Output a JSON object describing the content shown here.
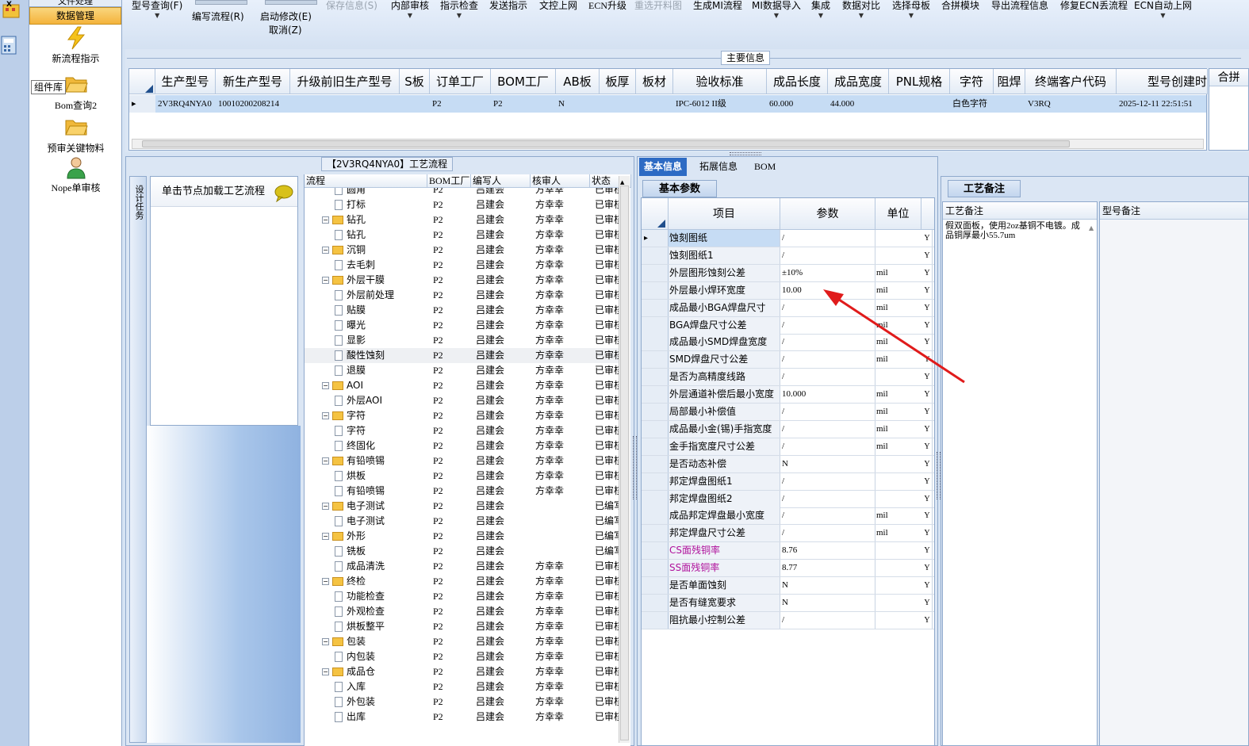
{
  "nav": {
    "top_label": "文件处理",
    "active_tab": "数据管理",
    "items": [
      {
        "label": "新流程指示"
      },
      {
        "label": "Bom查询2"
      },
      {
        "label": "预审关键物料"
      },
      {
        "label": "Nope单审核"
      }
    ],
    "tooltip": "组件库"
  },
  "toolbar": {
    "items": [
      {
        "label": "型号查询(F)",
        "dropdown": true,
        "disabled": false
      },
      {
        "label": "编写流程(R)",
        "dropdown": false,
        "disabled": false
      },
      {
        "label": "启动修改(E)",
        "dropdown": false,
        "disabled": false
      },
      {
        "label": "取消(Z)",
        "dropdown": false,
        "disabled": false
      },
      {
        "label": "保存信息(S)",
        "dropdown": false,
        "disabled": true
      },
      {
        "label": "内部审核",
        "dropdown": true,
        "disabled": false
      },
      {
        "label": "指示检查",
        "dropdown": true,
        "disabled": false
      },
      {
        "label": "发送指示",
        "dropdown": false,
        "disabled": false
      },
      {
        "label": "文控上网",
        "dropdown": false,
        "disabled": false
      },
      {
        "label": "ECN升级",
        "dropdown": false,
        "disabled": false
      },
      {
        "label": "重选开料图",
        "dropdown": false,
        "disabled": true
      },
      {
        "label": "生成MI流程",
        "dropdown": false,
        "disabled": false
      },
      {
        "label": "MI数据导入",
        "dropdown": true,
        "disabled": false
      },
      {
        "label": "集成",
        "dropdown": true,
        "disabled": false
      },
      {
        "label": "数据对比",
        "dropdown": true,
        "disabled": false
      },
      {
        "label": "选择母板",
        "dropdown": true,
        "disabled": false
      },
      {
        "label": "合拼模块",
        "dropdown": false,
        "disabled": false
      },
      {
        "label": "导出流程信息",
        "dropdown": false,
        "disabled": false
      },
      {
        "label": "修复ECN丢流程",
        "dropdown": false,
        "disabled": false
      },
      {
        "label": "ECN自动上网",
        "dropdown": true,
        "disabled": false
      }
    ]
  },
  "main_info": {
    "section_label": "主要信息",
    "right_label": "合拼",
    "columns": [
      "生产型号",
      "新生产型号",
      "升级前旧生产型号",
      "S板",
      "订单工厂",
      "BOM工厂",
      "AB板",
      "板厚",
      "板材",
      "验收标准",
      "成品长度",
      "成品宽度",
      "PNL规格",
      "字符",
      "阻焊",
      "终端客户代码",
      "型号创建时"
    ],
    "row": [
      "2V3RQ4NYA0",
      "10010200208214",
      "",
      "",
      "P2",
      "P2",
      "N",
      "",
      "",
      "IPC-6012 II级",
      "60.000",
      "44.000",
      "",
      "白色字符",
      "",
      "V3RQ",
      "2025-12-11 22:51:51"
    ]
  },
  "process": {
    "title": "【2V3RQ4NYA0】工艺流程",
    "side_tab": "设计任务",
    "load_hint": "单击节点加载工艺流程",
    "columns": [
      "流程",
      "BOM工厂",
      "编写人",
      "核审人",
      "状态"
    ],
    "rows": [
      {
        "name": "圆角",
        "level": 2,
        "bom": "P2",
        "writer": "吕建会",
        "reviewer": "方幸幸",
        "status": "已审核"
      },
      {
        "name": "打标",
        "level": 2,
        "bom": "P2",
        "writer": "吕建会",
        "reviewer": "方幸幸",
        "status": "已审核"
      },
      {
        "name": "钻孔",
        "level": 1,
        "bom": "P2",
        "writer": "吕建会",
        "reviewer": "方幸幸",
        "status": "已审核"
      },
      {
        "name": "钻孔",
        "level": 2,
        "bom": "P2",
        "writer": "吕建会",
        "reviewer": "方幸幸",
        "status": "已审核"
      },
      {
        "name": "沉铜",
        "level": 1,
        "bom": "P2",
        "writer": "吕建会",
        "reviewer": "方幸幸",
        "status": "已审核"
      },
      {
        "name": "去毛刺",
        "level": 2,
        "bom": "P2",
        "writer": "吕建会",
        "reviewer": "方幸幸",
        "status": "已审核"
      },
      {
        "name": "外层干膜",
        "level": 1,
        "bom": "P2",
        "writer": "吕建会",
        "reviewer": "方幸幸",
        "status": "已审核"
      },
      {
        "name": "外层前处理",
        "level": 2,
        "bom": "P2",
        "writer": "吕建会",
        "reviewer": "方幸幸",
        "status": "已审核"
      },
      {
        "name": "贴膜",
        "level": 2,
        "bom": "P2",
        "writer": "吕建会",
        "reviewer": "方幸幸",
        "status": "已审核"
      },
      {
        "name": "曝光",
        "level": 2,
        "bom": "P2",
        "writer": "吕建会",
        "reviewer": "方幸幸",
        "status": "已审核"
      },
      {
        "name": "显影",
        "level": 2,
        "bom": "P2",
        "writer": "吕建会",
        "reviewer": "方幸幸",
        "status": "已审核"
      },
      {
        "name": "酸性蚀刻",
        "level": 2,
        "bom": "P2",
        "writer": "吕建会",
        "reviewer": "方幸幸",
        "status": "已审核"
      },
      {
        "name": "退膜",
        "level": 2,
        "bom": "P2",
        "writer": "吕建会",
        "reviewer": "方幸幸",
        "status": "已审核"
      },
      {
        "name": "AOI",
        "level": 1,
        "bom": "P2",
        "writer": "吕建会",
        "reviewer": "方幸幸",
        "status": "已审核"
      },
      {
        "name": "外层AOI",
        "level": 2,
        "bom": "P2",
        "writer": "吕建会",
        "reviewer": "方幸幸",
        "status": "已审核"
      },
      {
        "name": "字符",
        "level": 1,
        "bom": "P2",
        "writer": "吕建会",
        "reviewer": "方幸幸",
        "status": "已审核"
      },
      {
        "name": "字符",
        "level": 2,
        "bom": "P2",
        "writer": "吕建会",
        "reviewer": "方幸幸",
        "status": "已审核"
      },
      {
        "name": "终固化",
        "level": 2,
        "bom": "P2",
        "writer": "吕建会",
        "reviewer": "方幸幸",
        "status": "已审核"
      },
      {
        "name": "有铅喷锡",
        "level": 1,
        "bom": "P2",
        "writer": "吕建会",
        "reviewer": "方幸幸",
        "status": "已审核"
      },
      {
        "name": "烘板",
        "level": 2,
        "bom": "P2",
        "writer": "吕建会",
        "reviewer": "方幸幸",
        "status": "已审核"
      },
      {
        "name": "有铅喷锡",
        "level": 2,
        "bom": "P2",
        "writer": "吕建会",
        "reviewer": "方幸幸",
        "status": "已审核"
      },
      {
        "name": "电子测试",
        "level": 1,
        "bom": "P2",
        "writer": "吕建会",
        "reviewer": "",
        "status": "已编写"
      },
      {
        "name": "电子测试",
        "level": 2,
        "bom": "P2",
        "writer": "吕建会",
        "reviewer": "",
        "status": "已编写"
      },
      {
        "name": "外形",
        "level": 1,
        "bom": "P2",
        "writer": "吕建会",
        "reviewer": "",
        "status": "已编写"
      },
      {
        "name": "铣板",
        "level": 2,
        "bom": "P2",
        "writer": "吕建会",
        "reviewer": "",
        "status": "已编写"
      },
      {
        "name": "成品清洗",
        "level": 2,
        "bom": "P2",
        "writer": "吕建会",
        "reviewer": "方幸幸",
        "status": "已审核"
      },
      {
        "name": "终检",
        "level": 1,
        "bom": "P2",
        "writer": "吕建会",
        "reviewer": "方幸幸",
        "status": "已审核"
      },
      {
        "name": "功能检查",
        "level": 2,
        "bom": "P2",
        "writer": "吕建会",
        "reviewer": "方幸幸",
        "status": "已审核"
      },
      {
        "name": "外观检查",
        "level": 2,
        "bom": "P2",
        "writer": "吕建会",
        "reviewer": "方幸幸",
        "status": "已审核"
      },
      {
        "name": "烘板整平",
        "level": 2,
        "bom": "P2",
        "writer": "吕建会",
        "reviewer": "方幸幸",
        "status": "已审核"
      },
      {
        "name": "包装",
        "level": 1,
        "bom": "P2",
        "writer": "吕建会",
        "reviewer": "方幸幸",
        "status": "已审核"
      },
      {
        "name": "内包装",
        "level": 2,
        "bom": "P2",
        "writer": "吕建会",
        "reviewer": "方幸幸",
        "status": "已审核"
      },
      {
        "name": "成品仓",
        "level": 1,
        "bom": "P2",
        "writer": "吕建会",
        "reviewer": "方幸幸",
        "status": "已审核"
      },
      {
        "name": "入库",
        "level": 2,
        "bom": "P2",
        "writer": "吕建会",
        "reviewer": "方幸幸",
        "status": "已审核"
      },
      {
        "name": "外包装",
        "level": 2,
        "bom": "P2",
        "writer": "吕建会",
        "reviewer": "方幸幸",
        "status": "已审核"
      },
      {
        "name": "出库",
        "level": 2,
        "bom": "P2",
        "writer": "吕建会",
        "reviewer": "方幸幸",
        "status": "已审核"
      }
    ],
    "selected_row": 11
  },
  "params": {
    "tabs": [
      "基本信息",
      "拓展信息",
      "BOM"
    ],
    "sub_tab": "基本参数",
    "columns": [
      "项目",
      "参数",
      "单位"
    ],
    "rows": [
      {
        "name": "蚀刻图纸",
        "value": "/",
        "unit": "",
        "flag": "Y",
        "highlight": false
      },
      {
        "name": "蚀刻图纸1",
        "value": "/",
        "unit": "",
        "flag": "Y",
        "highlight": false
      },
      {
        "name": "外层图形蚀刻公差",
        "value": "±10%",
        "unit": "mil",
        "flag": "Y",
        "highlight": false
      },
      {
        "name": "外层最小焊环宽度",
        "value": "10.00",
        "unit": "mil",
        "flag": "Y",
        "highlight": false
      },
      {
        "name": "成品最小BGA焊盘尺寸",
        "value": "/",
        "unit": "mil",
        "flag": "Y",
        "highlight": false
      },
      {
        "name": "BGA焊盘尺寸公差",
        "value": "/",
        "unit": "mil",
        "flag": "Y",
        "highlight": false
      },
      {
        "name": "成品最小SMD焊盘宽度",
        "value": "/",
        "unit": "mil",
        "flag": "Y",
        "highlight": false
      },
      {
        "name": "SMD焊盘尺寸公差",
        "value": "/",
        "unit": "mil",
        "flag": "Y",
        "highlight": false
      },
      {
        "name": "是否为高精度线路",
        "value": "/",
        "unit": "",
        "flag": "Y",
        "highlight": false
      },
      {
        "name": "外层通道补偿后最小宽度",
        "value": "10.000",
        "unit": "mil",
        "flag": "Y",
        "highlight": false
      },
      {
        "name": "局部最小补偿值",
        "value": "/",
        "unit": "mil",
        "flag": "Y",
        "highlight": false
      },
      {
        "name": "成品最小金(锡)手指宽度",
        "value": "/",
        "unit": "mil",
        "flag": "Y",
        "highlight": false
      },
      {
        "name": "金手指宽度尺寸公差",
        "value": "/",
        "unit": "mil",
        "flag": "Y",
        "highlight": false
      },
      {
        "name": "是否动态补偿",
        "value": "N",
        "unit": "",
        "flag": "Y",
        "highlight": false
      },
      {
        "name": "邦定焊盘图纸1",
        "value": "/",
        "unit": "",
        "flag": "Y",
        "highlight": false
      },
      {
        "name": "邦定焊盘图纸2",
        "value": "/",
        "unit": "",
        "flag": "Y",
        "highlight": false
      },
      {
        "name": "成品邦定焊盘最小宽度",
        "value": "/",
        "unit": "mil",
        "flag": "Y",
        "highlight": false
      },
      {
        "name": "邦定焊盘尺寸公差",
        "value": "/",
        "unit": "mil",
        "flag": "Y",
        "highlight": false
      },
      {
        "name": "CS面残铜率",
        "value": "8.76",
        "unit": "",
        "flag": "Y",
        "highlight": true
      },
      {
        "name": "SS面残铜率",
        "value": "8.77",
        "unit": "",
        "flag": "Y",
        "highlight": true
      },
      {
        "name": "是否单面蚀刻",
        "value": "N",
        "unit": "",
        "flag": "Y",
        "highlight": false
      },
      {
        "name": "是否有缝宽要求",
        "value": "N",
        "unit": "",
        "flag": "Y",
        "highlight": false
      },
      {
        "name": "阻抗最小控制公差",
        "value": "/",
        "unit": "",
        "flag": "Y",
        "highlight": false
      }
    ]
  },
  "remarks": {
    "tab": "工艺备注",
    "process_remark_label": "工艺备注",
    "process_remark_text": "假双面板，使用2oz基铜不电镀。成品铜厚最小55.7um",
    "model_remark_label": "型号备注"
  },
  "colors": {
    "highlight_name": "#b0129c",
    "arrow": "#e01b1b",
    "selection": "#c6dcf4",
    "active_tab": "#2d6bc4"
  }
}
